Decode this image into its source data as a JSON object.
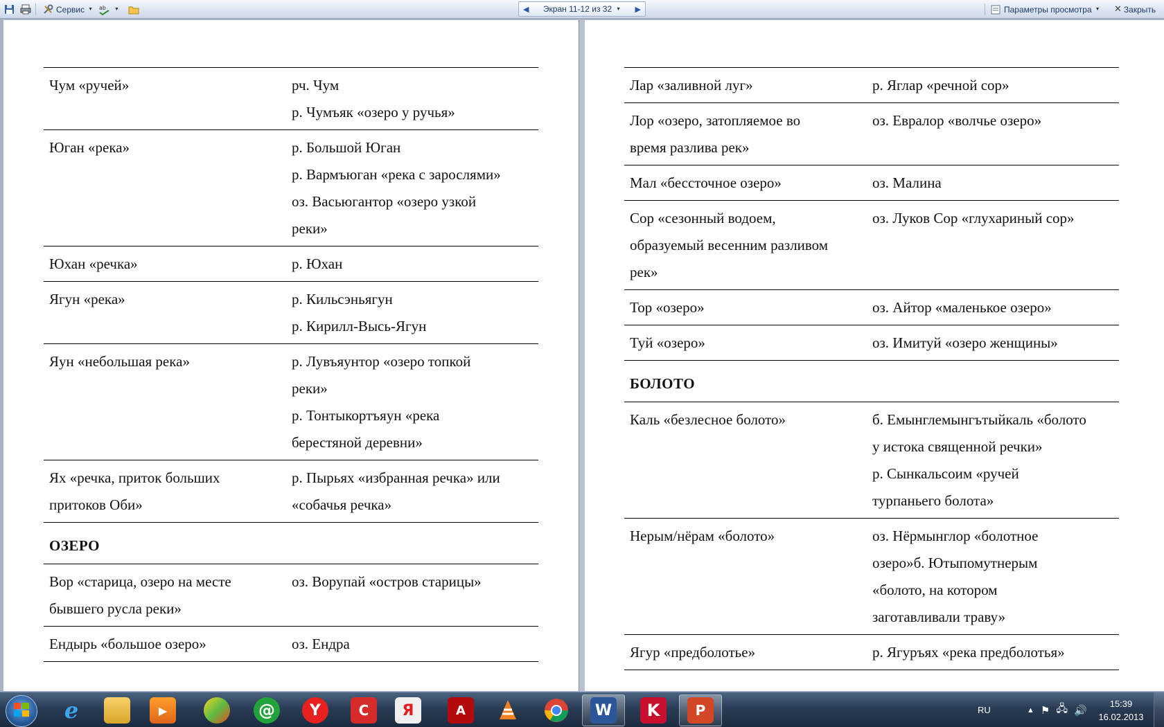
{
  "toolbar": {
    "service_label": "Сервис",
    "nav_label": "Экран 11-12 из 32",
    "view_params_label": "Параметры просмотра",
    "close_label": "Закрыть"
  },
  "left_page": {
    "rows": [
      {
        "term": [
          "Чум «ручей»"
        ],
        "examples": [
          "рч. Чум",
          "р. Чумъяк «озеро у ручья»"
        ]
      },
      {
        "term": [
          "Юган «река»"
        ],
        "examples": [
          "р. Большой Юган",
          "р. Вармъюган «река с зарослями»",
          "оз. Васьюгантор «озеро узкой",
          "реки»"
        ]
      },
      {
        "term": [
          "Юхан «речка»"
        ],
        "examples": [
          "р. Юхан"
        ]
      },
      {
        "term": [
          "Ягун «река»"
        ],
        "examples": [
          "р. Кильсэньягун",
          "р. Кирилл-Высь-Ягун"
        ]
      },
      {
        "term": [
          "Яун «небольшая река»"
        ],
        "examples": [
          "р. Лувъяунтор «озеро топкой",
          "реки»",
          "р. Тонтыкортъяун «река",
          "берестяной деревни»"
        ]
      },
      {
        "term": [
          "Ях «речка, приток больших",
          "притоков Оби»"
        ],
        "examples": [
          "р. Пырьях «избранная речка» или",
          "«собачья речка»"
        ]
      }
    ],
    "section_title": "ОЗЕРО",
    "rows2": [
      {
        "term": [
          "Вор «старица, озеро на месте",
          "бывшего русла реки»"
        ],
        "examples": [
          "оз. Ворупай «остров старицы»"
        ]
      },
      {
        "term": [
          "Ендырь «большое озеро»"
        ],
        "examples": [
          "оз. Ендра"
        ]
      }
    ]
  },
  "right_page": {
    "rows": [
      {
        "term": [
          "Лар «заливной луг»"
        ],
        "examples": [
          "р. Яглар «речной сор»"
        ]
      },
      {
        "term": [
          "Лор «озеро, затопляемое во",
          "время разлива рек»"
        ],
        "examples": [
          "оз. Евралор «волчье озеро»"
        ]
      },
      {
        "term": [
          "Мал «бессточное озеро»"
        ],
        "examples": [
          "оз. Малина"
        ]
      },
      {
        "term": [
          "Сор «сезонный водоем,",
          "образуемый весенним разливом",
          "рек»"
        ],
        "examples": [
          "оз. Луков Сор «глухариный сор»"
        ]
      },
      {
        "term": [
          "Тор «озеро»"
        ],
        "examples": [
          "оз. Айтор «маленькое озеро»"
        ]
      },
      {
        "term": [
          "Туй «озеро»"
        ],
        "examples": [
          "оз. Имитуй «озеро женщины»"
        ]
      }
    ],
    "section_title": "БОЛОТО",
    "rows2": [
      {
        "term": [
          "Каль «безлесное болото»"
        ],
        "examples": [
          "б. Емынглемынгътыйкаль «болото",
          "у истока священной речки»",
          "р. Сынкальсоим «ручей",
          "турпаньего болота»"
        ]
      },
      {
        "term": [
          "Нерым/нёрам «болото»"
        ],
        "examples": [
          "оз. Нёрмынглор «болотное",
          "озеро»б. Ютыпомутнерым",
          "«болото, на котором",
          "заготавливали траву»"
        ]
      },
      {
        "term": [
          "Ягур «предболотье»"
        ],
        "examples": [
          "р. Ягуръях «река предболотья»"
        ]
      }
    ]
  },
  "taskbar": {
    "apps": [
      "internet-explorer",
      "file-explorer",
      "media-player",
      "app-green",
      "mail-agent",
      "yandex-browser",
      "kaspersky-app",
      "yandex-bar",
      "adobe-reader",
      "vlc-player",
      "chrome",
      "word",
      "kaspersky",
      "powerpoint"
    ],
    "language": "RU",
    "time": "15:39",
    "date": "16.02.2013"
  }
}
